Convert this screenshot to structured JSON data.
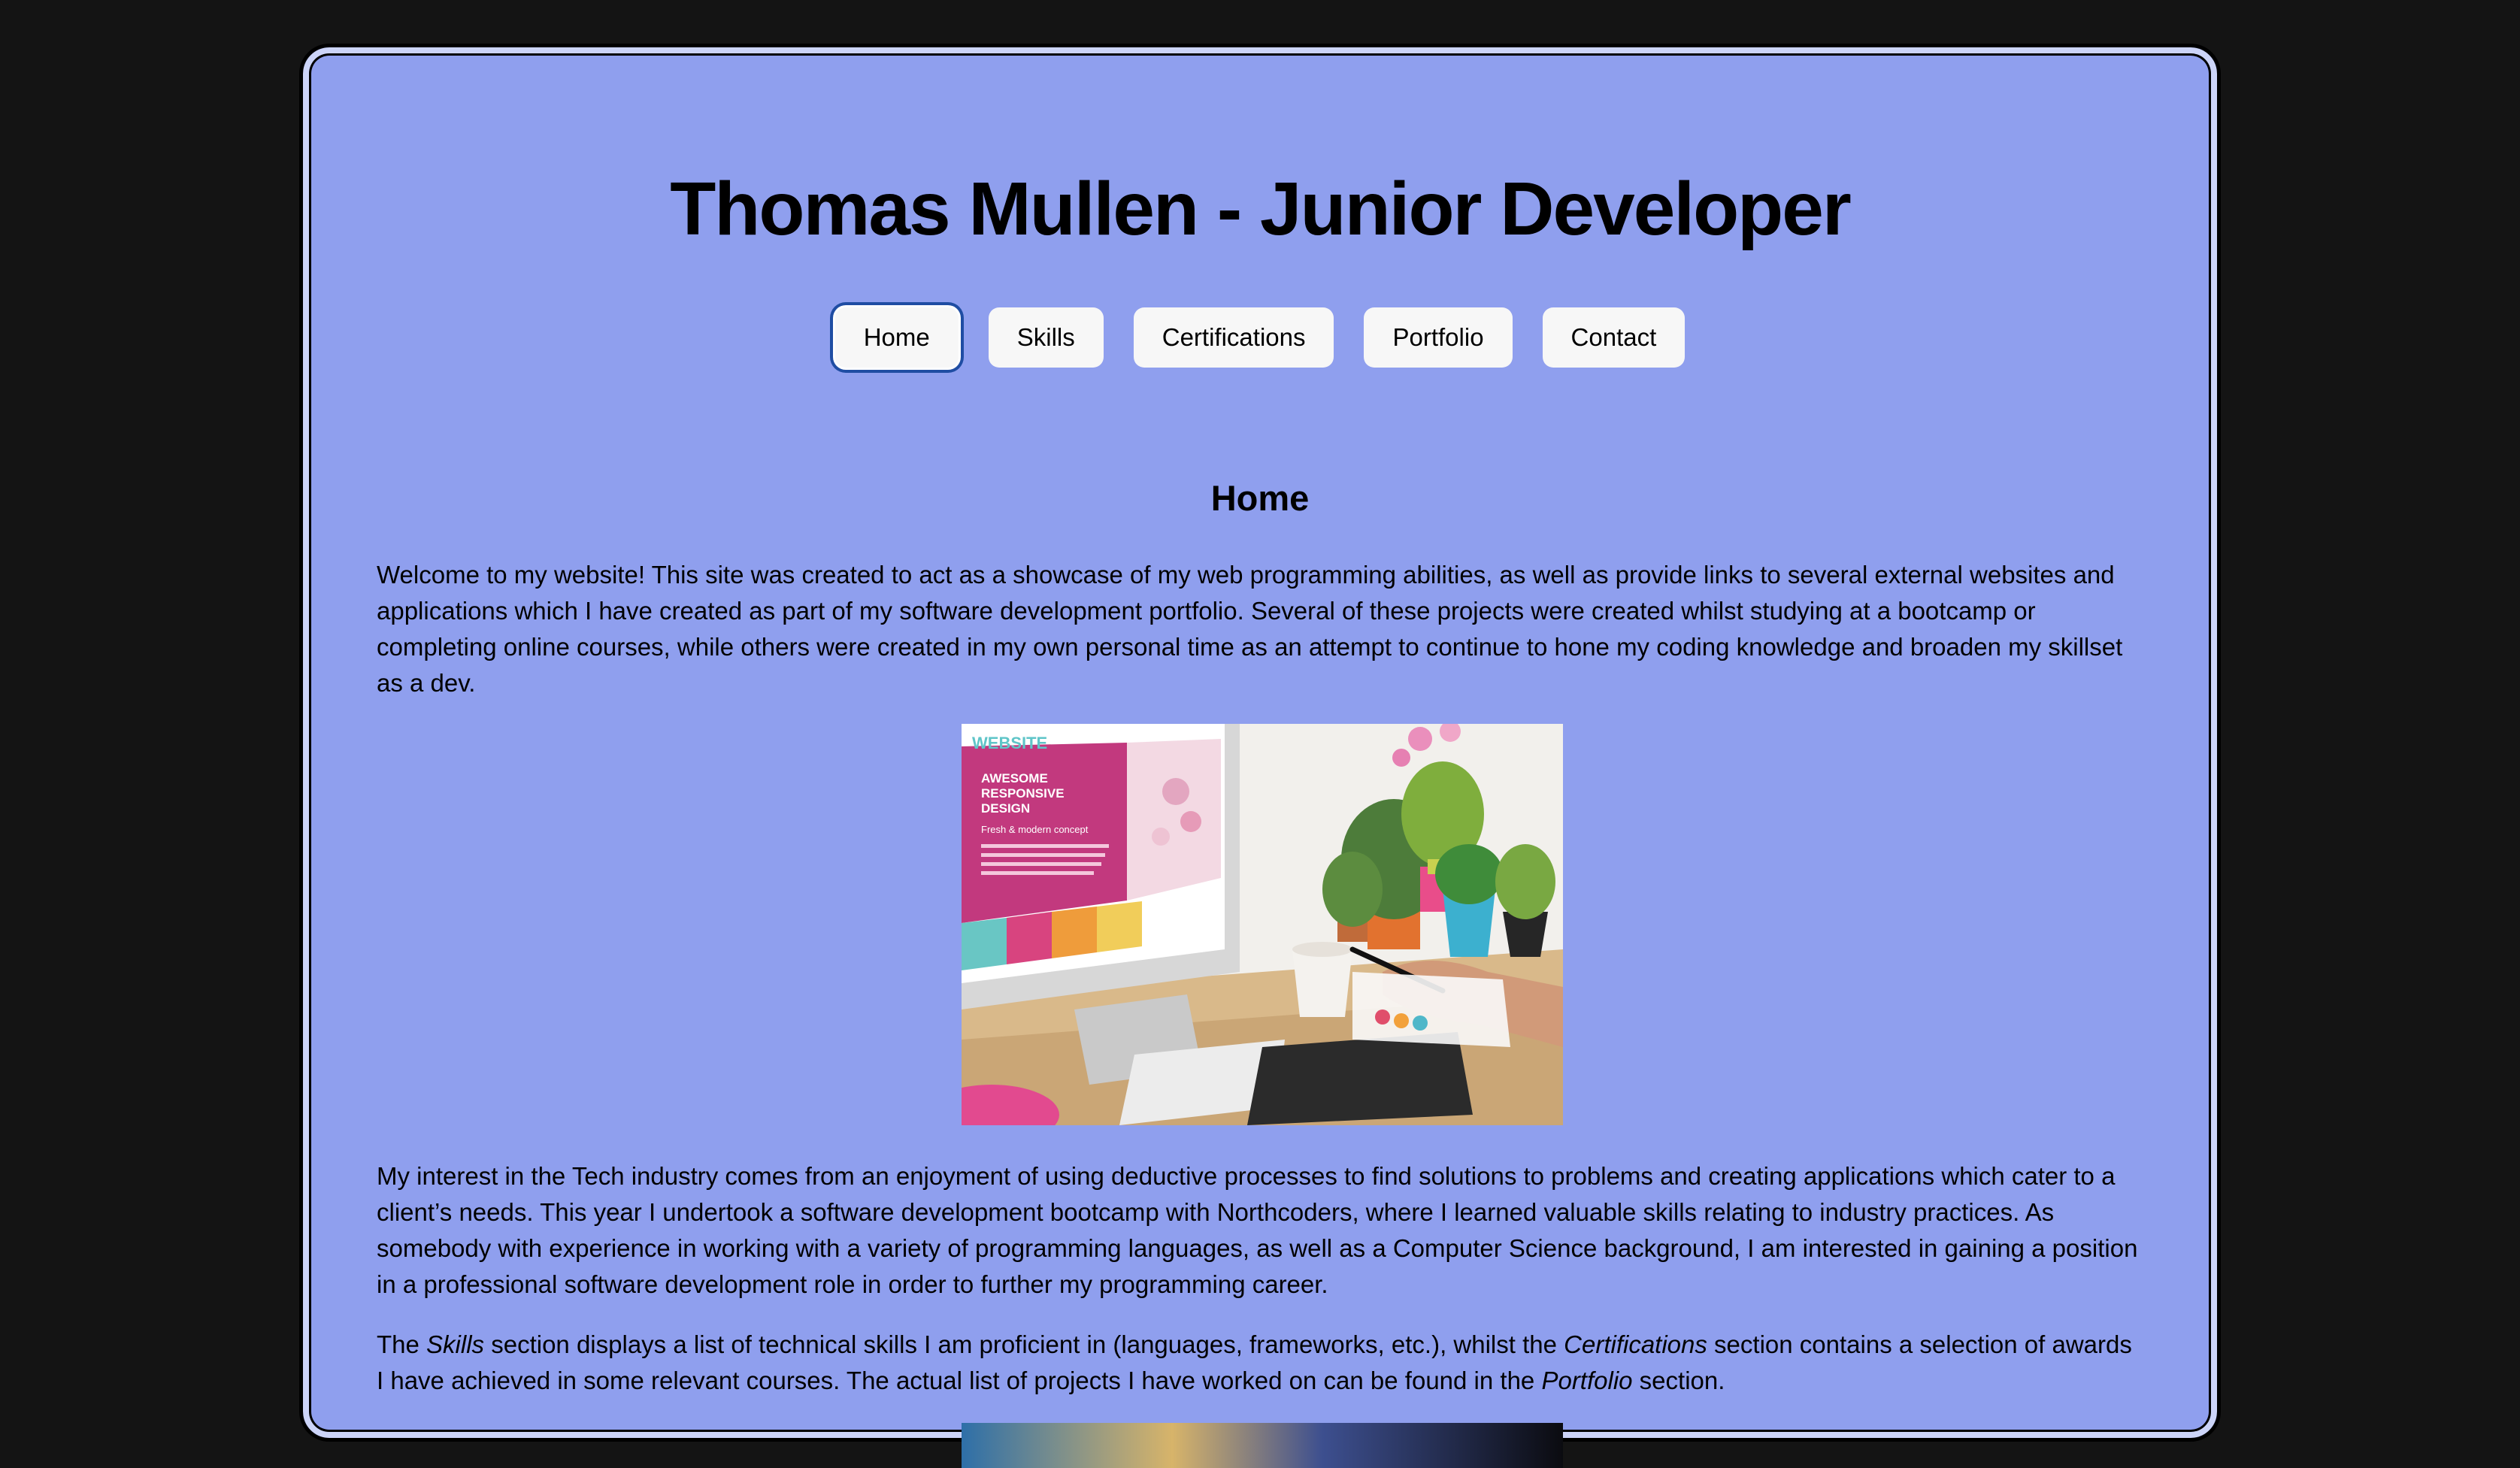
{
  "header": {
    "title": "Thomas Mullen - Junior Developer"
  },
  "nav": {
    "items": [
      {
        "label": "Home",
        "active": true
      },
      {
        "label": "Skills",
        "active": false
      },
      {
        "label": "Certifications",
        "active": false
      },
      {
        "label": "Portfolio",
        "active": false
      },
      {
        "label": "Contact",
        "active": false
      }
    ]
  },
  "main": {
    "heading": "Home",
    "intro": "Welcome to my website! This site was created to act as a showcase of my web programming abilities, as well as provide links to several external websites and applications which I have created as part of my software development portfolio. Several of these projects were created whilst studying at a bootcamp or completing online courses, while others were created in my own personal time as an attempt to continue to hone my coding knowledge and broaden my skillset as a dev.",
    "hero_image": {
      "screen_brand": "WEBSITE",
      "screen_headline_1": "AWESOME",
      "screen_headline_2": "RESPONSIVE",
      "screen_headline_3": "DESIGN",
      "screen_tagline": "Fresh & modern concept"
    },
    "interest": "My interest in the Tech industry comes from an enjoyment of using deductive processes to find solutions to problems and creating applications which cater to a client’s needs. This year I undertook a software development bootcamp with Northcoders, where I learned valuable skills relating to industry practices. As somebody with experience in working with a variety of programming languages, as well as a Computer Science background, I am interested in gaining a position in a professional software development role in order to further my programming career.",
    "sections_text": {
      "part1": "The ",
      "skills": "Skills",
      "part2": " section displays a list of technical skills I am proficient in (languages, frameworks, etc.), whilst the ",
      "certifications": "Certifications",
      "part3": " section contains a selection of awards I have achieved in some relevant courses. The actual list of projects I have worked on can be found in the ",
      "portfolio": "Portfolio",
      "part4": " section."
    }
  },
  "colors": {
    "page_background": "#141414",
    "panel_background": "#8f9fee",
    "button_background": "#f7f7f7",
    "active_ring": "#1f4da3"
  }
}
